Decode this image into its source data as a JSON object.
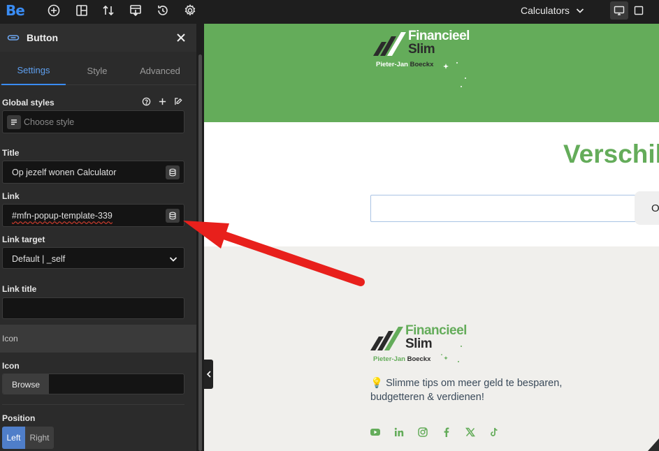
{
  "topbar": {
    "logo": "Be",
    "icons": [
      "plus-circle-icon",
      "layout-icon",
      "sort-icon",
      "import-icon",
      "history-icon",
      "gear-icon"
    ],
    "page_select": "Calculators",
    "devices": [
      "desktop-icon",
      "tablet-icon"
    ]
  },
  "panel": {
    "title": "Button",
    "tabs": [
      "Settings",
      "Style",
      "Advanced"
    ],
    "global_styles": {
      "label": "Global styles",
      "placeholder": "Choose style"
    },
    "title_field": {
      "label": "Title",
      "value": "Op jezelf wonen Calculator"
    },
    "link_field": {
      "label": "Link",
      "value": "#mfn-popup-template-339"
    },
    "link_target": {
      "label": "Link target",
      "value": "Default | _self"
    },
    "link_title": {
      "label": "Link title",
      "value": ""
    },
    "icon_section": "Icon",
    "icon_field": {
      "label": "Icon",
      "button": "Browse"
    },
    "position": {
      "label": "Position",
      "options": [
        "Left",
        "Right"
      ],
      "selected": "Left"
    }
  },
  "canvas": {
    "brand_top": {
      "name_line1": "Financieel",
      "name_line2": "Slim",
      "sub_first": "Pieter-Jan",
      "sub_last": "Boeckx"
    },
    "heading": "Verschil",
    "search_button_text": "O",
    "footer_brand": {
      "name_line1": "Financieel",
      "name_line2": "Slim",
      "sub_first": "Pieter-Jan",
      "sub_last": "Boeckx"
    },
    "tagline_emoji": "💡",
    "tagline": "Slimme tips om meer geld te besparen, budgetteren & verdienen!",
    "socials": [
      "youtube-icon",
      "linkedin-icon",
      "instagram-icon",
      "facebook-icon",
      "x-icon",
      "tiktok-icon"
    ]
  },
  "colors": {
    "accent": "#3a8cf3",
    "brand_green": "#64ac5a",
    "annotation_arrow": "#e8201c"
  }
}
